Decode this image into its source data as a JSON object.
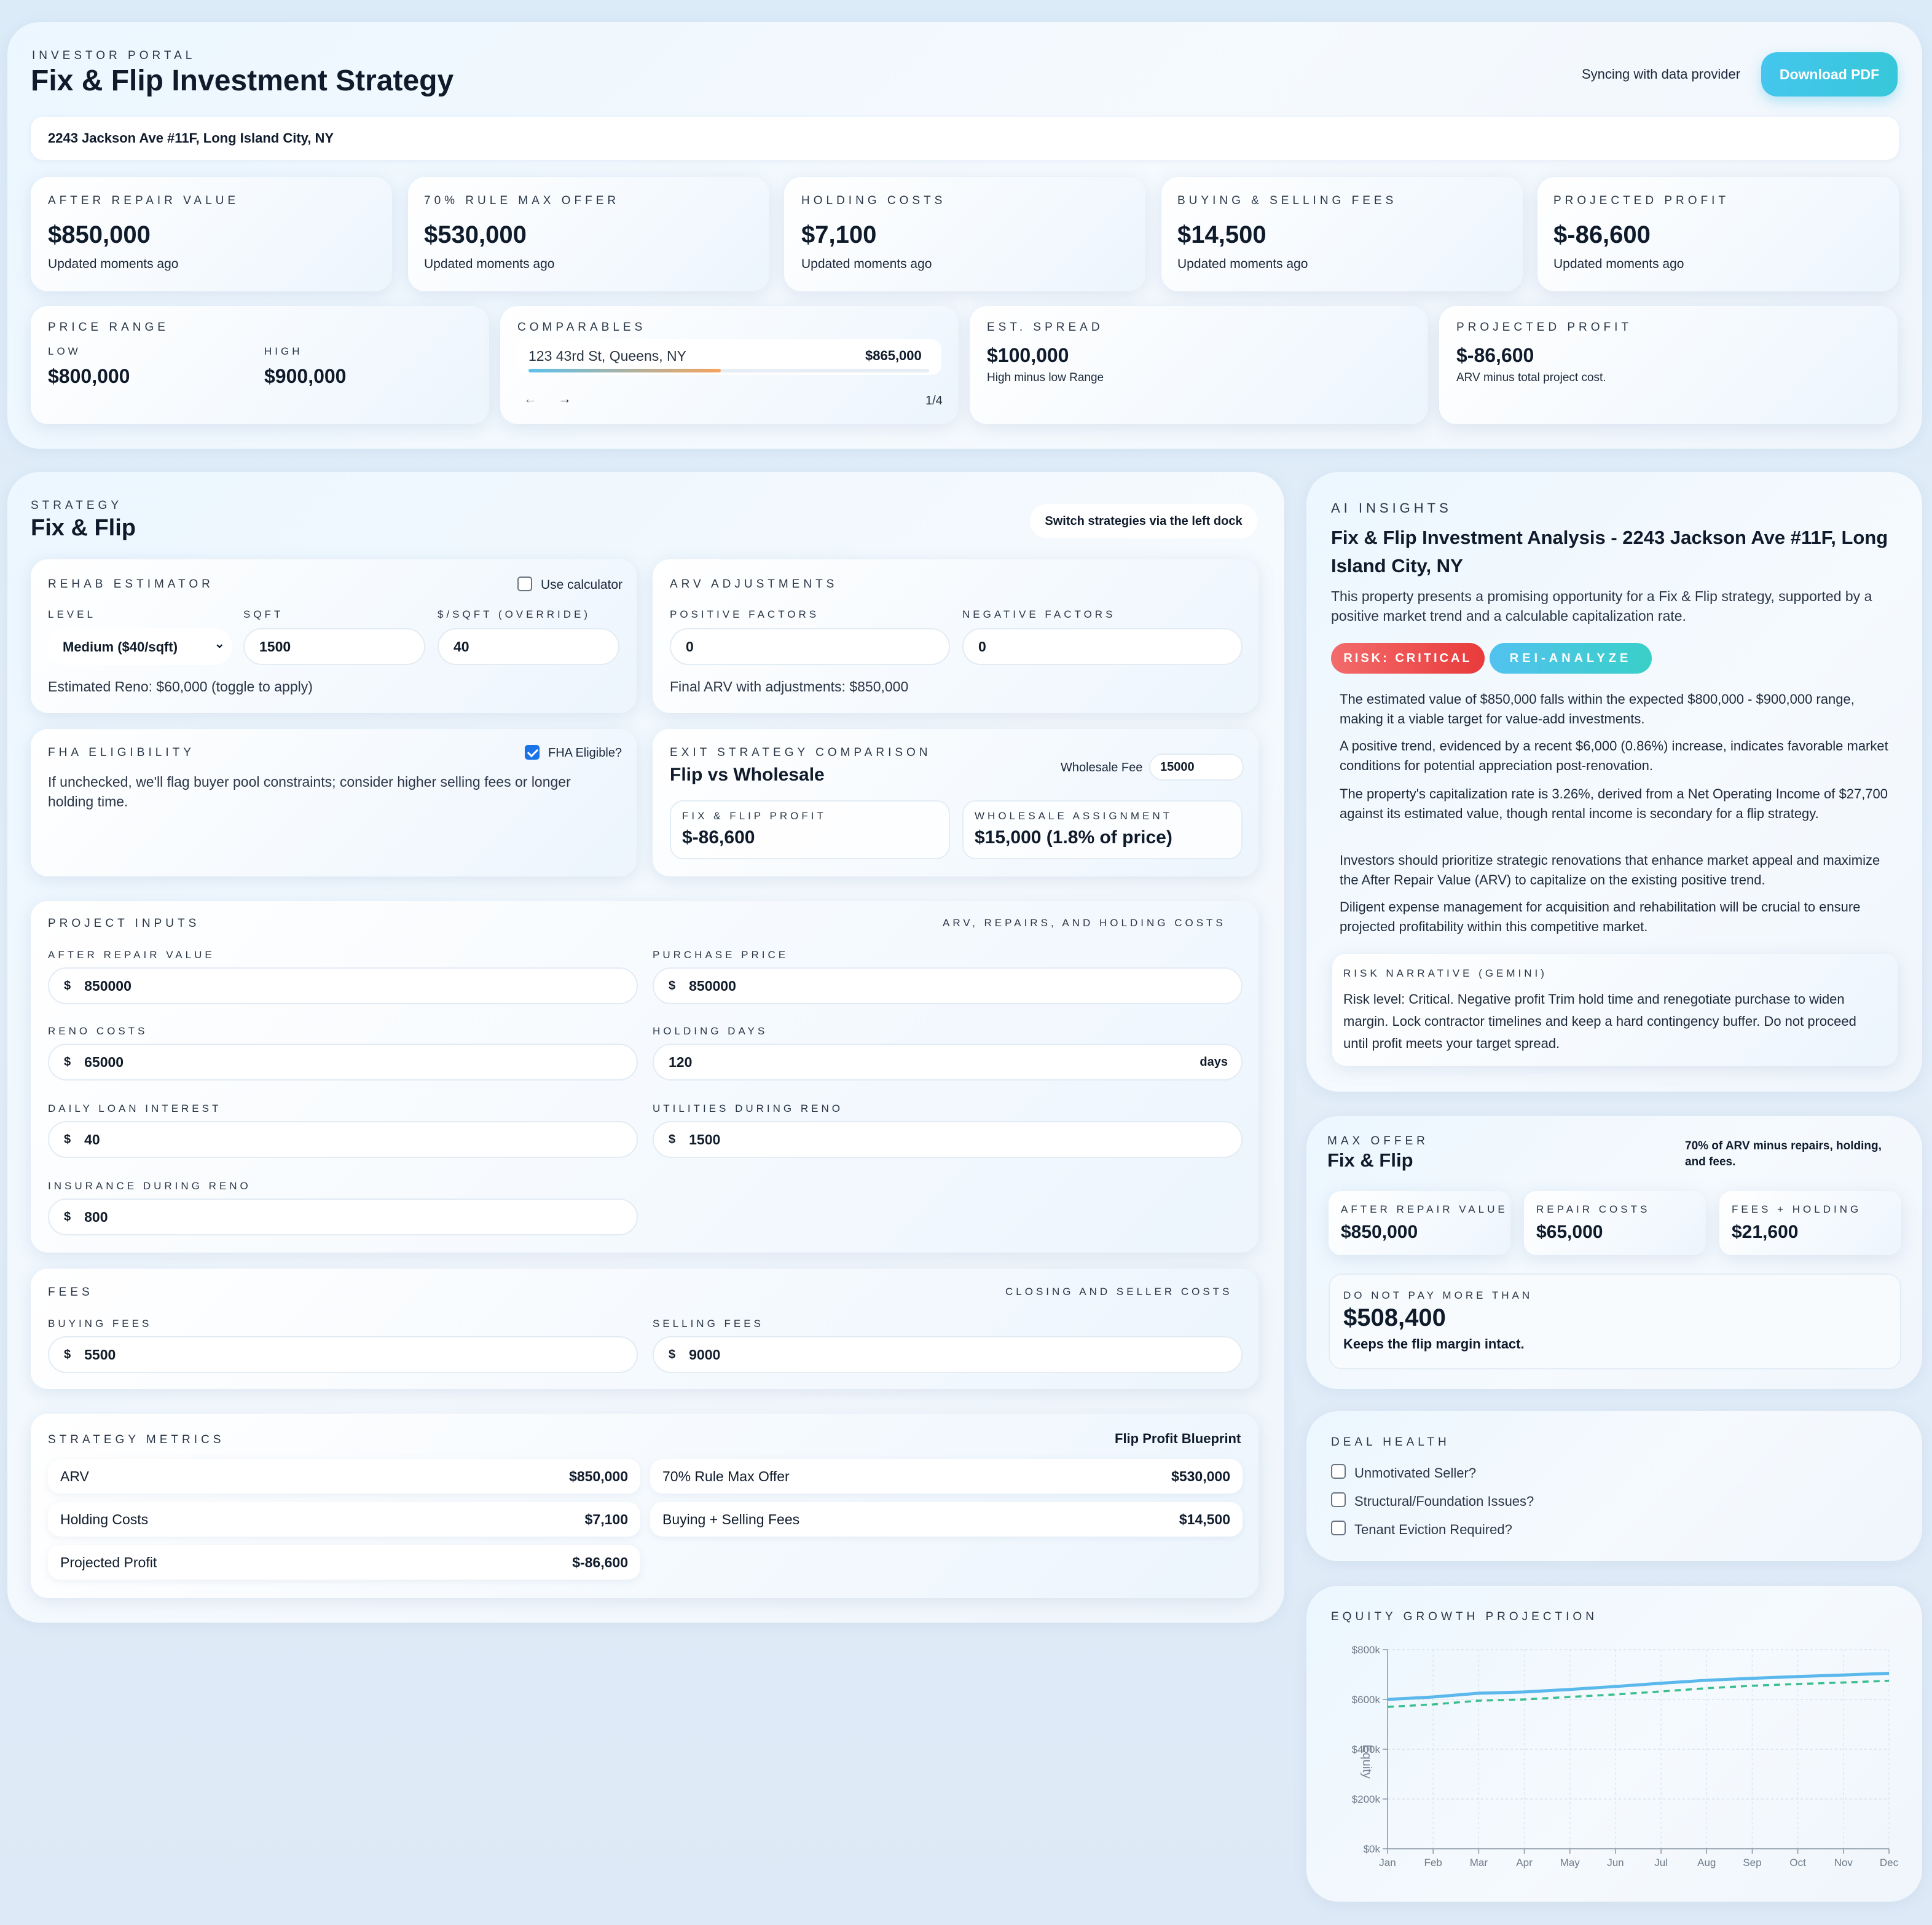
{
  "header": {
    "eyebrow": "INVESTOR PORTAL",
    "title": "Fix & Flip Investment Strategy",
    "sync_status": "Syncing with data provider",
    "download_label": "Download PDF",
    "address": "2243 Jackson Ave #11F, Long Island City, NY"
  },
  "kpis": [
    {
      "label": "AFTER REPAIR VALUE",
      "value": "$850,000",
      "sub": "Updated moments ago"
    },
    {
      "label": "70% RULE MAX OFFER",
      "value": "$530,000",
      "sub": "Updated moments ago"
    },
    {
      "label": "HOLDING COSTS",
      "value": "$7,100",
      "sub": "Updated moments ago"
    },
    {
      "label": "BUYING & SELLING FEES",
      "value": "$14,500",
      "sub": "Updated moments ago"
    },
    {
      "label": "PROJECTED PROFIT",
      "value": "$-86,600",
      "sub": "Updated moments ago"
    }
  ],
  "price_range": {
    "label": "PRICE RANGE",
    "low_label": "LOW",
    "low": "$800,000",
    "high_label": "HIGH",
    "high": "$900,000"
  },
  "comparables": {
    "label": "COMPARABLES",
    "address": "123 43rd St, Queens, NY",
    "price": "$865,000",
    "pager": "1/4",
    "progress": 0.48
  },
  "spread": {
    "label": "EST. SPREAD",
    "value": "$100,000",
    "sub": "High minus low Range"
  },
  "profit2": {
    "label": "PROJECTED PROFIT",
    "value": "$-86,600",
    "sub": "ARV minus total project cost."
  },
  "strategy": {
    "eyebrow": "STRATEGY",
    "title": "Fix & Flip",
    "hint": "Switch strategies via the left dock",
    "rehab": {
      "label": "REHAB ESTIMATOR",
      "calc_label": "Use calculator",
      "level_label": "LEVEL",
      "level_value": "Medium ($40/sqft)",
      "sqft_label": "SQFT",
      "sqft_value": "1500",
      "override_label": "$/SQFT (OVERRIDE)",
      "override_value": "40",
      "estimate": "Estimated Reno: $60,000 (toggle to apply)"
    },
    "arv_adj": {
      "label": "ARV ADJUSTMENTS",
      "pos_label": "POSITIVE FACTORS",
      "pos_value": "0",
      "neg_label": "NEGATIVE FACTORS",
      "neg_value": "0",
      "final": "Final ARV with adjustments: $850,000"
    },
    "fha": {
      "label": "FHA ELIGIBILITY",
      "check_label": "FHA Eligible?",
      "desc": "If unchecked, we'll flag buyer pool constraints; consider higher selling fees or longer holding time."
    },
    "exit": {
      "label": "EXIT STRATEGY COMPARISON",
      "title": "Flip vs Wholesale",
      "fee_label": "Wholesale Fee",
      "fee_value": "15000",
      "flip_label": "FIX & FLIP PROFIT",
      "flip_value": "$-86,600",
      "wholesale_label": "WHOLESALE ASSIGNMENT",
      "wholesale_value": "$15,000 (1.8% of price)"
    },
    "inputs": {
      "label": "PROJECT INPUTS",
      "right_label": "ARV, REPAIRS, AND HOLDING COSTS",
      "currency": "$",
      "arv_label": "AFTER REPAIR VALUE",
      "arv": "850000",
      "purchase_label": "PURCHASE PRICE",
      "purchase": "850000",
      "reno_label": "RENO COSTS",
      "reno": "65000",
      "days_label": "HOLDING DAYS",
      "days": "120",
      "days_unit": "days",
      "interest_label": "DAILY LOAN INTEREST",
      "interest": "40",
      "utilities_label": "UTILITIES DURING RENO",
      "utilities": "1500",
      "insurance_label": "INSURANCE DURING RENO",
      "insurance": "800"
    },
    "fees": {
      "label": "FEES",
      "right_label": "CLOSING AND SELLER COSTS",
      "buy_label": "BUYING FEES",
      "buy": "5500",
      "sell_label": "SELLING FEES",
      "sell": "9000"
    },
    "metrics": {
      "label": "STRATEGY METRICS",
      "right": "Flip Profit Blueprint",
      "rows": [
        {
          "k": "ARV",
          "v": "$850,000"
        },
        {
          "k": "70% Rule Max Offer",
          "v": "$530,000"
        },
        {
          "k": "Holding Costs",
          "v": "$7,100"
        },
        {
          "k": "Buying + Selling Fees",
          "v": "$14,500"
        },
        {
          "k": "Projected Profit",
          "v": "$-86,600"
        }
      ]
    }
  },
  "ai": {
    "eyebrow": "AI INSIGHTS",
    "title": "Fix & Flip Investment Analysis - 2243 Jackson Ave #11F, Long Island City, NY",
    "summary": "This property presents a promising opportunity for a Fix & Flip strategy, supported by a positive market trend and a calculable capitalization rate.",
    "badge_risk": "RISK: CRITICAL",
    "badge_tool": "REI-ANALYZE",
    "points": [
      "The estimated value of $850,000 falls within the expected $800,000 - $900,000 range, making it a viable target for value-add investments.",
      "A positive trend, evidenced by a recent $6,000 (0.86%) increase, indicates favorable market conditions for potential appreciation post-renovation.",
      "The property's capitalization rate is 3.26%, derived from a Net Operating Income of $27,700 against its estimated value, though rental income is secondary for a flip strategy.",
      "Investors should prioritize strategic renovations that enhance market appeal and maximize the After Repair Value (ARV) to capitalize on the existing positive trend.",
      "Diligent expense management for acquisition and rehabilitation will be crucial to ensure projected profitability within this competitive market."
    ],
    "narrative_label": "RISK NARRATIVE (GEMINI)",
    "narrative": "Risk level: Critical. Negative profit Trim hold time and renegotiate purchase to widen margin. Lock contractor timelines and keep a hard contingency buffer. Do not proceed until profit meets your target spread."
  },
  "max_offer": {
    "eyebrow": "MAX OFFER",
    "title": "Fix & Flip",
    "note": "70% of ARV minus repairs, holding, and fees.",
    "arv_label": "AFTER REPAIR VALUE",
    "arv": "$850,000",
    "repair_label": "REPAIR COSTS",
    "repair": "$65,000",
    "fees_label": "FEES + HOLDING",
    "fees": "$21,600",
    "limit_label": "DO NOT PAY MORE THAN",
    "limit": "$508,400",
    "limit_sub": "Keeps the flip margin intact."
  },
  "deal_health": {
    "label": "DEAL HEALTH",
    "items": [
      "Unmotivated Seller?",
      "Structural/Foundation Issues?",
      "Tenant Eviction Required?"
    ]
  },
  "colors": {
    "accent": "#3cc3ec",
    "risk": "#ef5350",
    "line1": "#5bb8ec",
    "line2": "#3cbf8e"
  },
  "chart_data": {
    "type": "line",
    "title": "EQUITY GROWTH PROJECTION",
    "ylabel": "Equity",
    "x": [
      "Jan",
      "Feb",
      "Mar",
      "Apr",
      "May",
      "Jun",
      "Jul",
      "Aug",
      "Sep",
      "Oct",
      "Nov",
      "Dec"
    ],
    "y_ticks": [
      "$0k",
      "$200k",
      "$400k",
      "$600k",
      "$800k"
    ],
    "ylim": [
      0,
      800000
    ],
    "grid": true,
    "series": [
      {
        "style": "solid",
        "values": [
          600000,
          610000,
          625000,
          630000,
          640000,
          652000,
          665000,
          677000,
          685000,
          692000,
          698000,
          705000
        ]
      },
      {
        "style": "dashed",
        "values": [
          570000,
          580000,
          595000,
          600000,
          610000,
          620000,
          632000,
          645000,
          655000,
          662000,
          668000,
          675000
        ]
      }
    ]
  }
}
